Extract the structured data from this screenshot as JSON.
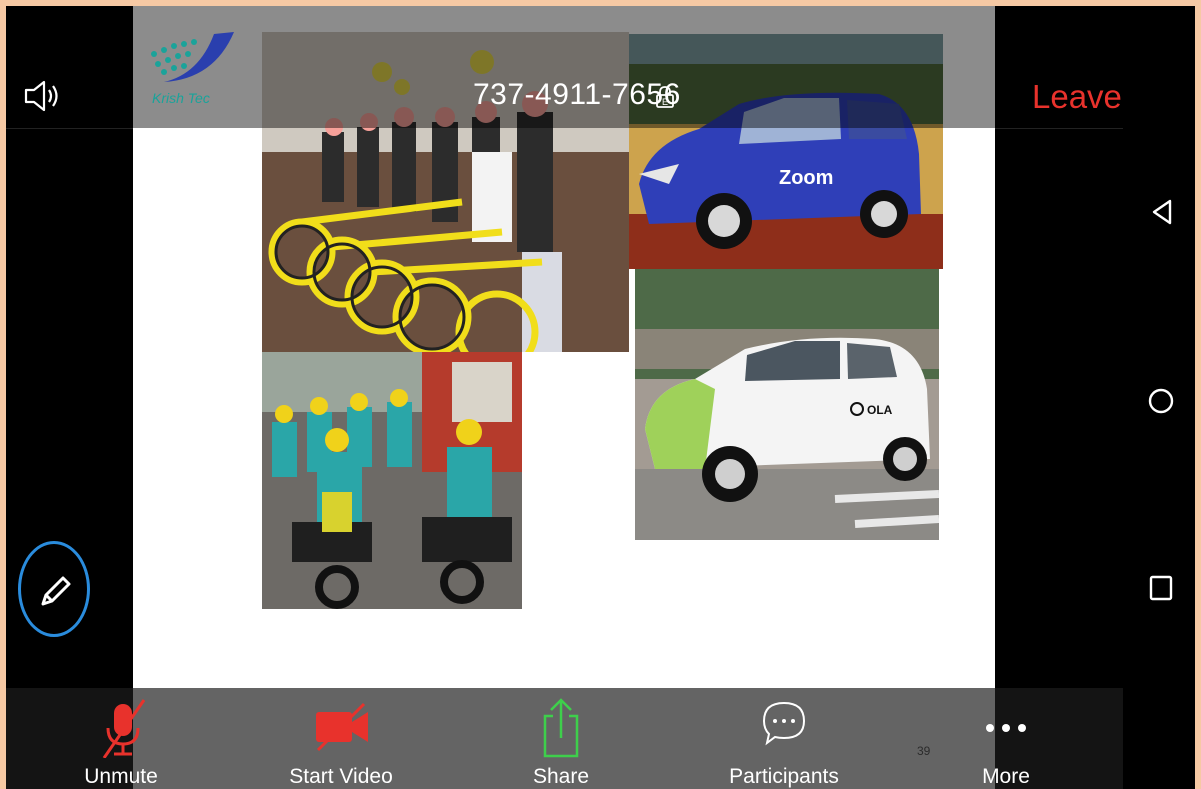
{
  "header": {
    "meeting_id": "737-4911-7656",
    "leave_label": "Leave"
  },
  "logo": {
    "text": "Krish Tec"
  },
  "toolbar": {
    "unmute_label": "Unmute",
    "start_video_label": "Start Video",
    "share_label": "Share",
    "participants_label": "Participants",
    "more_label": "More"
  },
  "slide": {
    "page_number": "39",
    "photos": [
      "bicycle-sharing-photo",
      "zoomcar-photo",
      "ola-cab-photo",
      "bike-taxi-photo"
    ],
    "zoom_car_text": "Zoom",
    "ola_text": "OLA"
  },
  "colors": {
    "leave": "#e8322c",
    "pen_ring": "#2a8cdd",
    "share": "#3ecf4b",
    "muted": "#e8322c"
  },
  "icons": [
    "speaker-icon",
    "lock-icon",
    "pencil-icon",
    "back-nav-icon",
    "home-nav-icon",
    "recents-nav-icon",
    "mic-muted-icon",
    "video-off-icon",
    "share-icon",
    "chat-icon",
    "more-icon"
  ]
}
